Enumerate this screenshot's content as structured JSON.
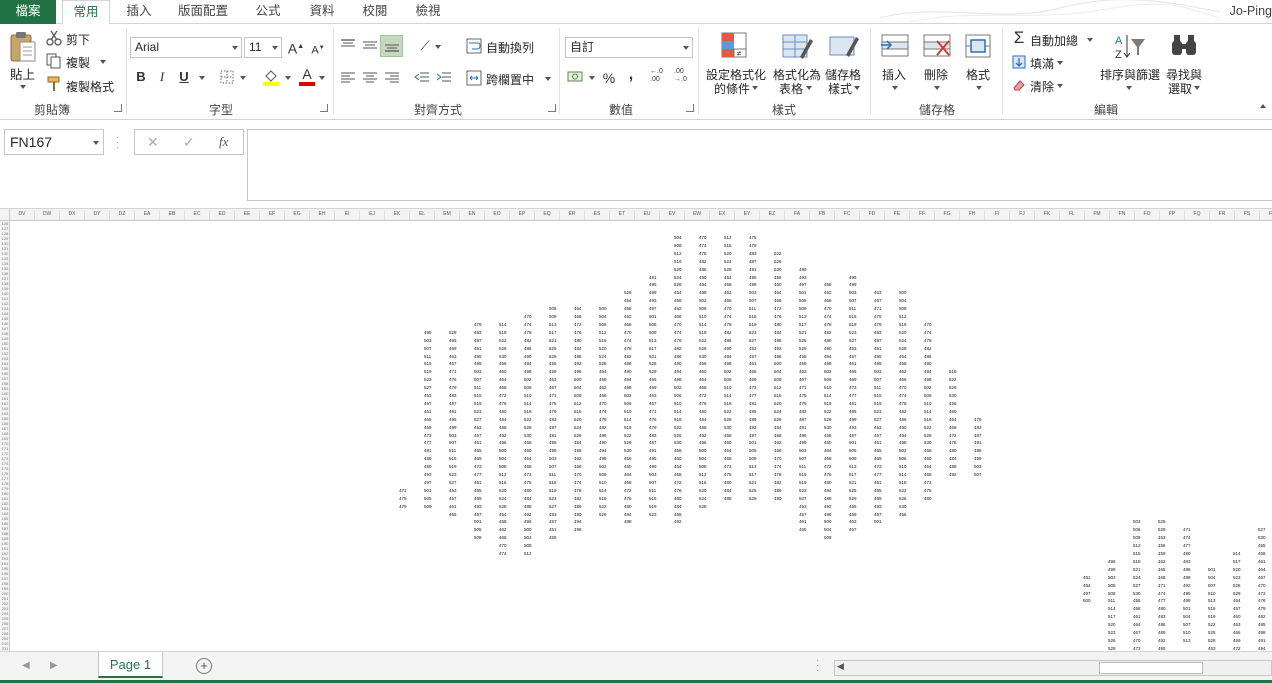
{
  "tabs": [
    "檔案",
    "常用",
    "插入",
    "版面配置",
    "公式",
    "資料",
    "校閱",
    "檢視"
  ],
  "user": "Jo-Ping",
  "clipboard": {
    "paste": "貼上",
    "cut": "剪下",
    "copy": "複製",
    "format_painter": "複製格式",
    "label": "剪貼簿"
  },
  "font": {
    "name": "Arial",
    "size": "11",
    "label": "字型",
    "bold": "B",
    "italic": "I",
    "underline": "U",
    "grow": "A",
    "shrink": "A",
    "font_color_glyph": "A"
  },
  "alignment": {
    "wrap": "自動換列",
    "merge": "跨欄置中",
    "label": "對齊方式"
  },
  "number": {
    "format": "自訂",
    "label": "數值",
    "percent": "%",
    "comma": ",",
    "inc_decimal": "←.0 .00",
    "dec_decimal": ".00 →.0"
  },
  "styles": {
    "conditional": [
      "設定格式化",
      "的條件"
    ],
    "as_table": [
      "格式化為",
      "表格"
    ],
    "cell_styles": [
      "儲存格",
      "樣式"
    ],
    "label": "樣式"
  },
  "cells": {
    "insert": "插入",
    "delete": "刪除",
    "format": "格式",
    "label": "儲存格"
  },
  "editing": {
    "autosum": "自動加總",
    "fill": "填滿",
    "clear": "清除",
    "sort": [
      "排序與篩選"
    ],
    "find": [
      "尋找與",
      "選取"
    ],
    "label": "編輯"
  },
  "name_box": "FN167",
  "formula_icons": {
    "cancel": "✕",
    "enter": "✓",
    "fx": "fx"
  },
  "columns": [
    "DV",
    "DW",
    "DX",
    "DY",
    "DZ",
    "EA",
    "EB",
    "EC",
    "ED",
    "EE",
    "EF",
    "EG",
    "EH",
    "EI",
    "EJ",
    "EK",
    "EL",
    "EM",
    "EN",
    "EO",
    "EP",
    "EQ",
    "ER",
    "ES",
    "ET",
    "EU",
    "EV",
    "EW",
    "EX",
    "EY",
    "EZ",
    "FA",
    "FB",
    "FC",
    "FD",
    "FE",
    "FF",
    "FG",
    "FH",
    "FI",
    "FJ",
    "FK",
    "FL",
    "FM",
    "FN",
    "FO",
    "FP",
    "FQ",
    "FR",
    "FS",
    "FT"
  ],
  "row_start": 126,
  "cell_texts": [
    "453",
    "454",
    "455",
    "456",
    "457",
    "458",
    "459",
    "460",
    "461",
    "462",
    "463",
    "464",
    "465",
    "466",
    "467",
    "468",
    "469",
    "470",
    "471",
    "472",
    "473",
    "474",
    "475",
    "476",
    "477",
    "478",
    "479",
    "480",
    "481",
    "482",
    "483",
    "484",
    "485",
    "486",
    "487",
    "488",
    "489",
    "490",
    "491",
    "492",
    "493",
    "494",
    "495",
    "496",
    "497",
    "498",
    "499",
    "500",
    "501",
    "502",
    "503",
    "504",
    "505",
    "506",
    "507",
    "508",
    "509",
    "510",
    "511",
    "512",
    "513",
    "514",
    "515",
    "516",
    "517",
    "518",
    "519",
    "520",
    "521",
    "522",
    "523",
    "524",
    "525",
    "526",
    "527",
    "528",
    "529",
    "530"
  ],
  "sheet_tab": "Page 1",
  "colors": {
    "accent": "#217346",
    "ribbon_bg": "#ffffff",
    "header_bg": "#f3f3f3"
  }
}
